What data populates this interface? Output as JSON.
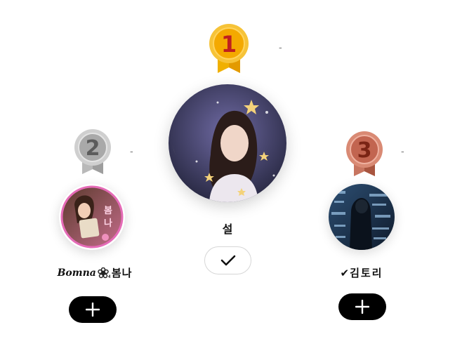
{
  "ranking": [
    {
      "rank": "1",
      "name": "설",
      "action": "check-icon",
      "medal": "gold",
      "dash": "-"
    },
    {
      "rank": "2",
      "name_script": "Bomna",
      "name_hangul": "봄나",
      "action": "plus-icon",
      "medal": "silver",
      "dash": "-"
    },
    {
      "rank": "3",
      "name_check": "✔",
      "name_hangul": "김토리",
      "action": "plus-icon",
      "medal": "bronze",
      "dash": "-"
    }
  ],
  "colors": {
    "gold": "#f4b400",
    "silver": "#a8a8a8",
    "bronze": "#c46a53",
    "button": "#000000"
  }
}
